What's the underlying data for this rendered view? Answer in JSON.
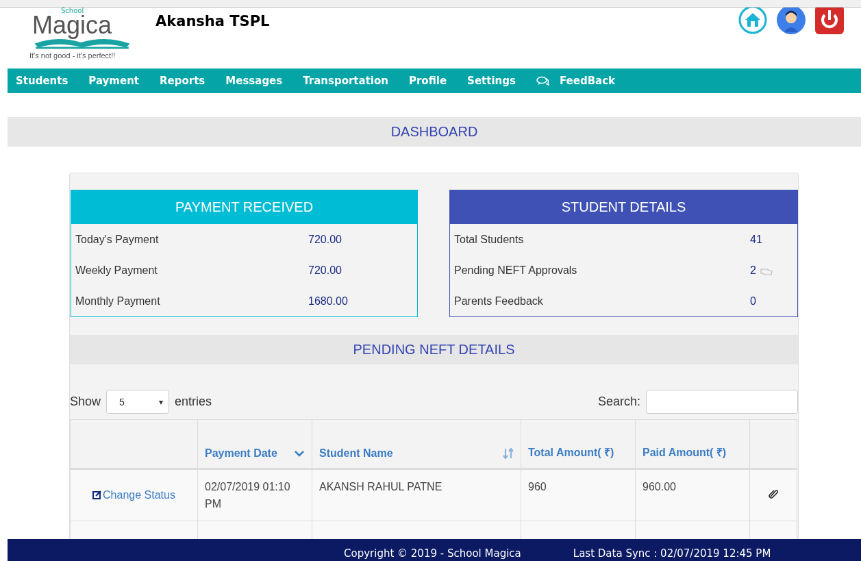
{
  "header": {
    "logo_small": "School",
    "logo": "Magica",
    "tagline": "It's not good - it's perfect!!",
    "org": "Akansha TSPL"
  },
  "nav": [
    {
      "label": "Students",
      "kind": "text"
    },
    {
      "label": "Payment",
      "kind": "text"
    },
    {
      "label": "Reports",
      "kind": "text"
    },
    {
      "label": "Messages",
      "kind": "text"
    },
    {
      "label": "Transportation",
      "kind": "text"
    },
    {
      "label": "Profile",
      "kind": "text"
    },
    {
      "label": "Settings",
      "kind": "text"
    },
    {
      "label": "FeedBack",
      "kind": "chat"
    }
  ],
  "dashboard_title": "DASHBOARD",
  "payment_panel": {
    "title": "PAYMENT RECEIVED",
    "rows": [
      {
        "label": "Today's Payment",
        "value": "720.00"
      },
      {
        "label": "Weekly Payment",
        "value": "720.00"
      },
      {
        "label": "Monthly Payment",
        "value": "1680.00"
      }
    ]
  },
  "student_panel": {
    "title": "STUDENT DETAILS",
    "rows": [
      {
        "label": "Total Students",
        "value": "41",
        "pointer": false
      },
      {
        "label": "Pending NEFT Approvals",
        "value": "2",
        "pointer": true
      },
      {
        "label": "Parents Feedback",
        "value": "0",
        "pointer": false
      }
    ]
  },
  "neft": {
    "title": "PENDING NEFT DETAILS",
    "show_label": "Show",
    "page_size": "5",
    "entries_label": "entries",
    "search_label": "Search:",
    "caret": "▾",
    "columns": [
      {
        "kind": "plain"
      },
      {
        "label": "Payment Date",
        "kind": "sorted"
      },
      {
        "label": "Student Name",
        "kind": "sortable"
      },
      {
        "label": "Total Amount( ₹)",
        "kind": "plain"
      },
      {
        "label": "Paid Amount( ₹)",
        "kind": "plain"
      },
      {
        "kind": "plain"
      }
    ],
    "rows": [
      {
        "action": "Change Status",
        "date": "02/07/2019 01:10 PM",
        "name": "AKANSH RAHUL PATNE",
        "total": "960",
        "paid": "960.00"
      }
    ]
  },
  "footer": {
    "copyright": "Copyright © 2019 - School Magica",
    "sync": "Last Data Sync : 02/07/2019 12:45 PM"
  }
}
